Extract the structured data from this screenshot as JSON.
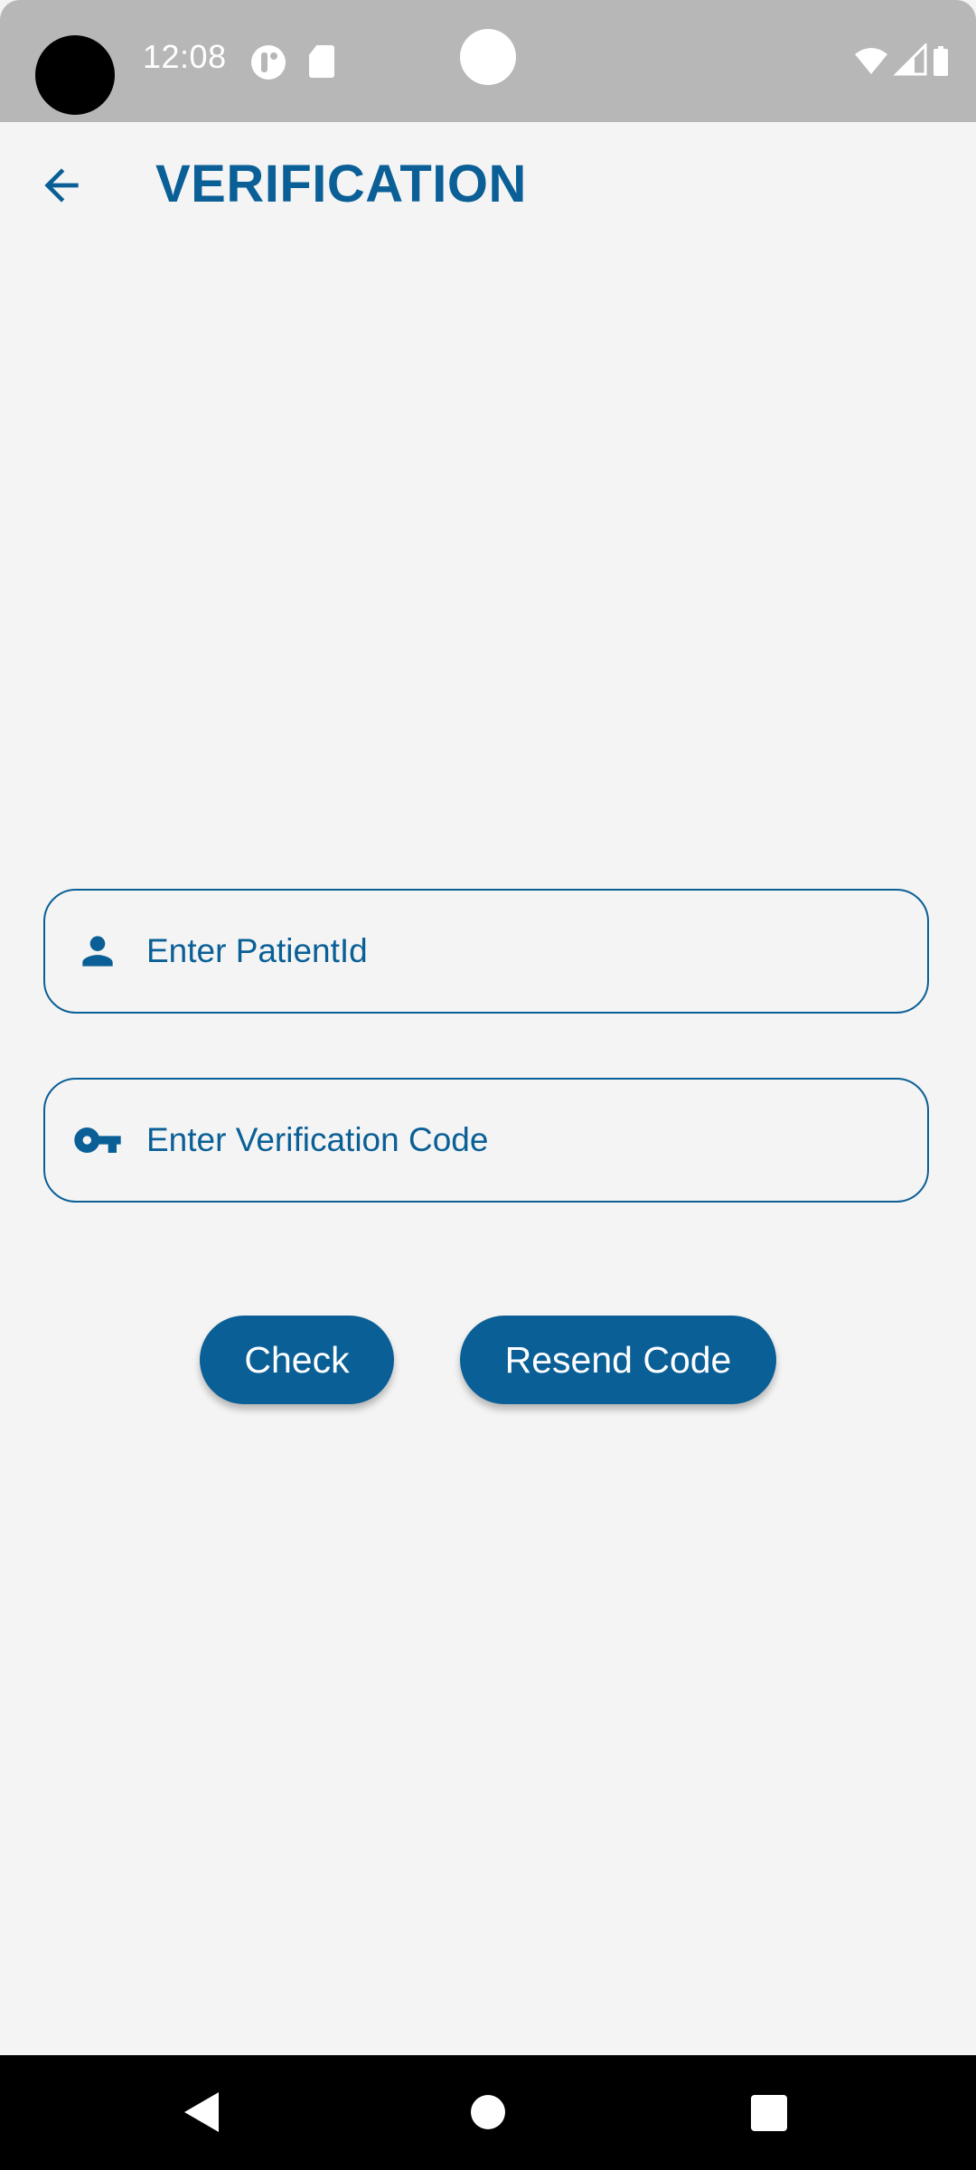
{
  "status_bar": {
    "time": "12:08",
    "icons": [
      "notification-app-icon",
      "sd-card-icon",
      "wifi-icon",
      "cell-signal-icon",
      "battery-icon"
    ]
  },
  "app_bar": {
    "back_icon": "arrow-back-icon",
    "title": "VERIFICATION"
  },
  "form": {
    "patient_id": {
      "icon": "person-icon",
      "placeholder": "Enter PatientId",
      "value": ""
    },
    "verification_code": {
      "icon": "key-icon",
      "placeholder": "Enter Verification Code",
      "value": ""
    }
  },
  "actions": {
    "check_label": "Check",
    "resend_label": "Resend Code"
  },
  "nav_bar": {
    "icons": [
      "nav-back-icon",
      "nav-home-icon",
      "nav-recents-icon"
    ]
  },
  "colors": {
    "accent": "#0a5f96",
    "background": "#f4f4f4",
    "status_bar": "#b7b7b7"
  }
}
